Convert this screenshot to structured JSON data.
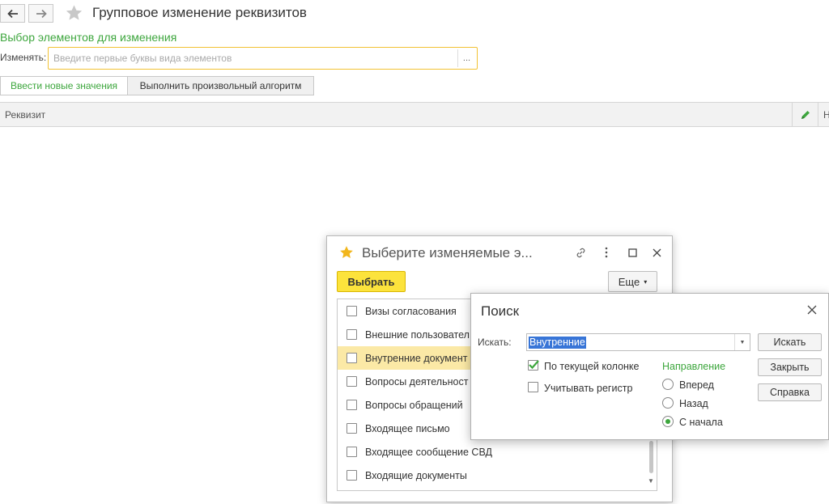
{
  "main": {
    "page_title": "Групповое изменение реквизитов",
    "section_title": "Выбор элементов для изменения",
    "change_label": "Изменять:",
    "change_placeholder": "Введите первые буквы вида элементов",
    "dots_label": "...",
    "tabs": [
      {
        "label": "Ввести новые значения",
        "active": true
      },
      {
        "label": "Выполнить произвольный алгоритм",
        "active": false
      }
    ],
    "grid_header": {
      "column": "Реквизит",
      "column_next": "Н"
    }
  },
  "chooser": {
    "title": "Выберите изменяемые э...",
    "select_button": "Выбрать",
    "more_button": "Еще",
    "items": [
      {
        "label": "Визы согласования",
        "checked": false,
        "selected": false
      },
      {
        "label": "Внешние пользовател",
        "checked": false,
        "selected": false
      },
      {
        "label": "Внутренние документ",
        "checked": false,
        "selected": true
      },
      {
        "label": "Вопросы деятельност",
        "checked": false,
        "selected": false
      },
      {
        "label": "Вопросы обращений",
        "checked": false,
        "selected": false
      },
      {
        "label": "Входящее письмо",
        "checked": false,
        "selected": false
      },
      {
        "label": "Входящее сообщение СВД",
        "checked": false,
        "selected": false
      },
      {
        "label": "Входящие документы",
        "checked": false,
        "selected": false
      }
    ]
  },
  "search": {
    "title": "Поиск",
    "find_label": "Искать:",
    "find_value": "Внутренние",
    "current_column_label": "По текущей колонке",
    "current_column_checked": true,
    "case_label": "Учитывать регистр",
    "case_checked": false,
    "direction_title": "Направление",
    "directions": [
      {
        "label": "Вперед",
        "checked": false
      },
      {
        "label": "Назад",
        "checked": false
      },
      {
        "label": "С начала",
        "checked": true
      }
    ],
    "buttons": {
      "find": "Искать",
      "close": "Закрыть",
      "help": "Справка"
    }
  },
  "colors": {
    "accent_green": "#3da63d",
    "select_yellow": "#fce33c",
    "highlight_row": "#fbe9a6",
    "selection_blue": "#3875d7"
  }
}
